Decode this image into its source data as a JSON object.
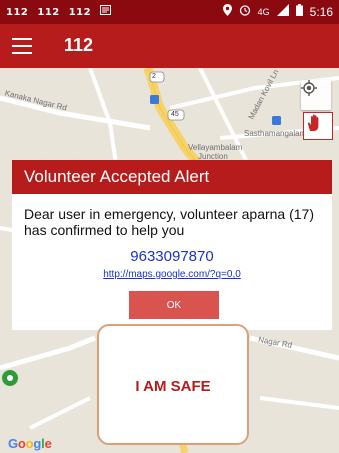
{
  "status_bar": {
    "carriers": [
      "112",
      "112",
      "112"
    ],
    "network": "4G",
    "time": "5:16"
  },
  "app_bar": {
    "title": "112",
    "menu_icon": "hamburger-icon"
  },
  "map": {
    "labels": {
      "road1": "Kanaka Nagar Rd",
      "place1": "Vellayambalam",
      "place1_sub": "Junction",
      "place2": "Sasthamangalam",
      "road2": "Madan Kovil Ln",
      "road3": "Nagar Rd",
      "shield1": "2",
      "shield2": "45"
    },
    "attribution": "Google",
    "controls": {
      "locate_icon": "my-location-icon",
      "hand_icon": "hand-stop-icon"
    }
  },
  "dialog": {
    "title": "Volunteer Accepted Alert",
    "message": "Dear user in emergency, volunteer aparna (17) has confirmed to help you",
    "phone": "9633097870",
    "link": "http://maps.google.com/?q=0,0",
    "ok_label": "OK"
  },
  "safe_button": {
    "label": "I AM SAFE"
  },
  "colors": {
    "primary": "#b71c1c",
    "status_bar": "#8a0a10",
    "ok_button": "#d9534f",
    "link": "#1a33c8"
  }
}
